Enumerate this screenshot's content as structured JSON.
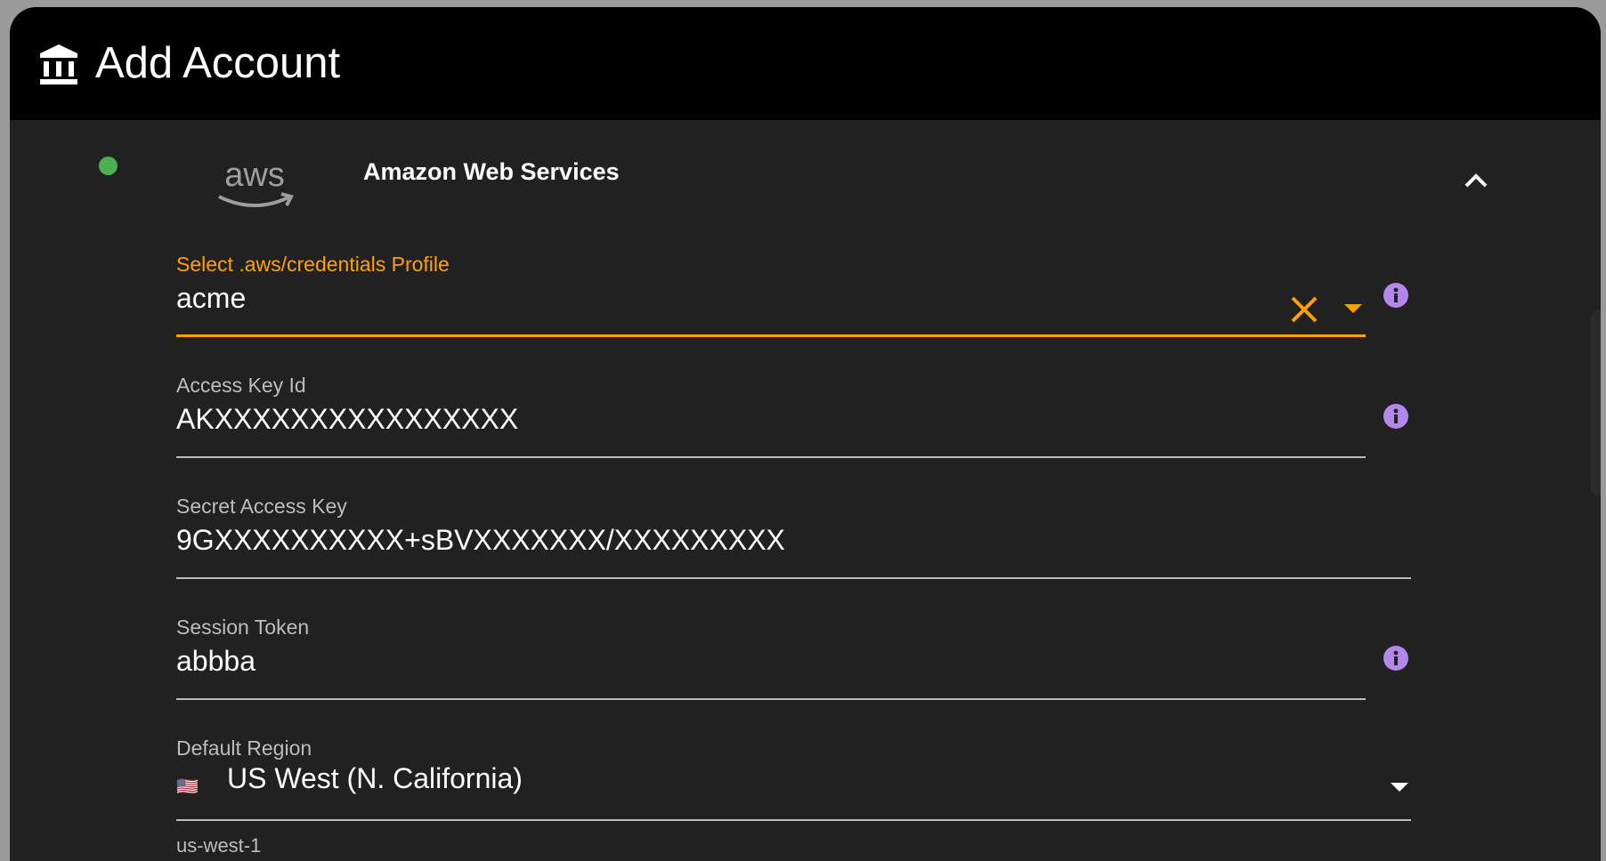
{
  "header": {
    "title": "Add Account",
    "icon": "bank-icon"
  },
  "provider": {
    "name": "Amazon Web Services",
    "logo_text": "aws",
    "status_color": "#4caf50",
    "expanded": true
  },
  "fields": {
    "profile": {
      "label": "Select .aws/credentials Profile",
      "value": "acme",
      "focused": true
    },
    "access_key_id": {
      "label": "Access Key Id",
      "value": "AKXXXXXXXXXXXXXXXX"
    },
    "secret_access_key": {
      "label": "Secret Access Key",
      "value": "9GXXXXXXXXXX+sBVXXXXXXX/XXXXXXXXX"
    },
    "session_token": {
      "label": "Session Token",
      "value": "abbba"
    },
    "default_region": {
      "label": "Default Region",
      "value": "US West (N. California)",
      "flag": "🇺🇸",
      "code": "us-west-1"
    }
  },
  "colors": {
    "accent": "#ffa000",
    "info": "#b388eb",
    "background": "#212121",
    "header": "#000000"
  }
}
